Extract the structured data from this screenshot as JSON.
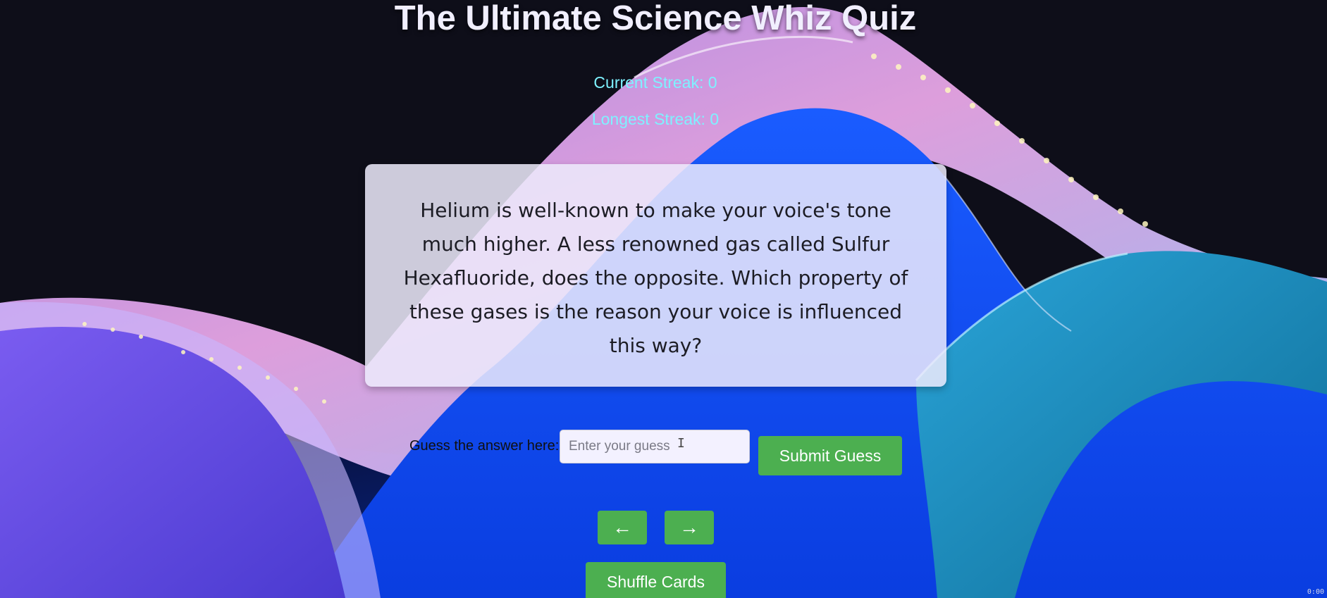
{
  "page": {
    "title": "The Ultimate Science Whiz Quiz"
  },
  "streaks": {
    "current": "Current Streak: 0",
    "longest": "Longest Streak: 0"
  },
  "card": {
    "question": "Helium is well-known to make your voice's tone much higher. A less renowned gas called Sulfur Hexafluoride, does the opposite. Which property of these gases is the reason your voice is influenced this way?"
  },
  "guess": {
    "label": "Guess the answer here:",
    "placeholder": "Enter your guess",
    "value": ""
  },
  "buttons": {
    "submit": "Submit Guess",
    "prev": "←",
    "next": "→",
    "shuffle": "Shuffle Cards"
  },
  "corner": {
    "stamp": "0:00"
  },
  "colors": {
    "background": "#0e0e19",
    "accent_green": "#4caf50",
    "streak_text": "#7ef2ff",
    "card_bg": "#eceafc"
  }
}
